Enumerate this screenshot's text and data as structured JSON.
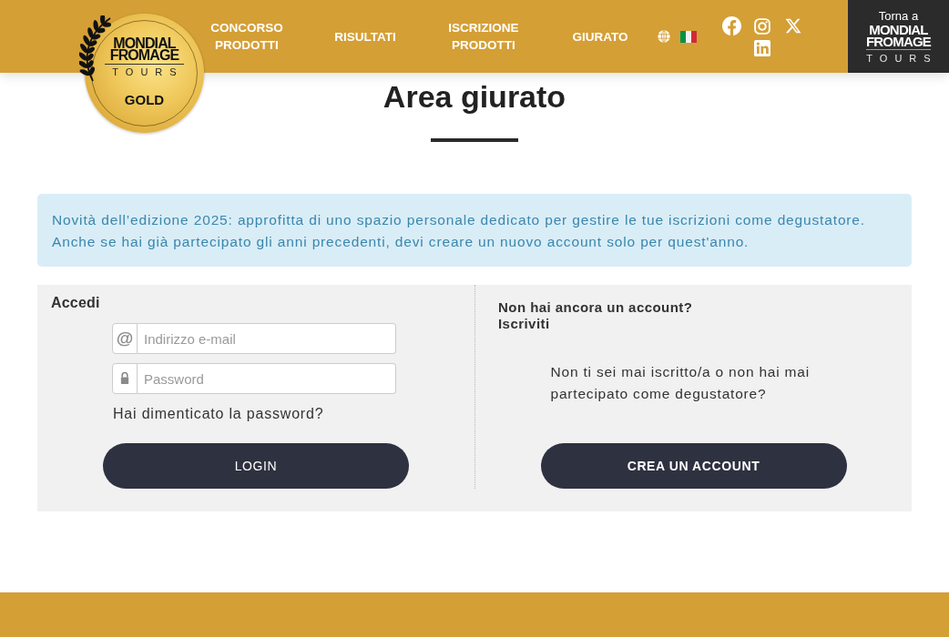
{
  "header": {
    "logo": {
      "wordmark": "MONDIAL FROMAGE",
      "tagline": "TOURS",
      "badge": "GOLD"
    },
    "nav": [
      {
        "label": "CONCORSO PRODOTTI"
      },
      {
        "label": "RISULTATI"
      },
      {
        "label": "ISCRIZIONE PRODOTTI"
      },
      {
        "label": "GIURATO"
      }
    ],
    "language": [
      {
        "kind": "globe"
      },
      {
        "kind": "flag"
      }
    ],
    "social": [
      {
        "kind": "facebook"
      },
      {
        "kind": "instagram"
      },
      {
        "kind": "x"
      },
      {
        "kind": "linkedin"
      }
    ],
    "back_link": {
      "label": "Torna a",
      "wordmark": "MONDIAL FROMAGE",
      "tagline": "TOURS"
    }
  },
  "page": {
    "title": "Area giurato"
  },
  "notice": {
    "text": "Novità dell’edizione 2025: approfitta di uno spazio personale dedicato per gestire le tue iscrizioni come degustatore. Anche se hai già partecipato gli anni precedenti, devi creare un nuovo account solo per quest'anno."
  },
  "login": {
    "heading": "Accedi",
    "fields": [
      {
        "kind": "email",
        "addon": "@",
        "placeholder": "Indirizzo e-mail"
      },
      {
        "kind": "password",
        "placeholder": "Password"
      }
    ],
    "forgot_link": "Hai dimenticato la password?",
    "button": "LOGIN"
  },
  "signup": {
    "heading": "Non hai ancora un account?",
    "subheading": "Iscriviti",
    "text": "Non ti sei mai iscritto/a o non hai mai partecipato come degustatore?",
    "button": "CREA UN ACCOUNT"
  }
}
